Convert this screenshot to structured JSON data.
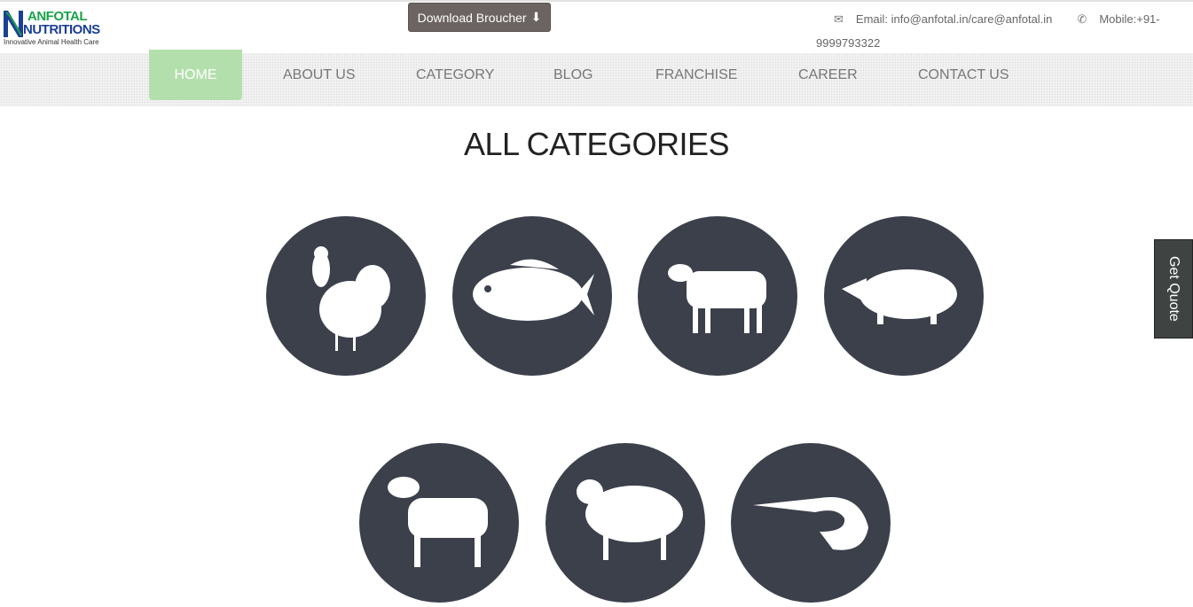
{
  "header": {
    "logo": {
      "line1": "ANFOTAL",
      "line2": "NUTRITIONS",
      "tagline": "Innovative Animal Health Care"
    },
    "download_label": "Download Broucher",
    "email": "Email: info@anfotal.in/care@anfotal.in",
    "mobile": "Mobile:+91-9999793322"
  },
  "nav": {
    "items": [
      {
        "label": "HOME",
        "active": true
      },
      {
        "label": "ABOUT US"
      },
      {
        "label": "CATEGORY"
      },
      {
        "label": "BLOG"
      },
      {
        "label": "FRANCHISE"
      },
      {
        "label": "CAREER"
      },
      {
        "label": "CONTACT US"
      }
    ]
  },
  "main": {
    "title": "ALL CATEGORIES",
    "categories": [
      {
        "icon": "chicken-icon"
      },
      {
        "icon": "fish-icon"
      },
      {
        "icon": "cow-icon"
      },
      {
        "icon": "pig-icon"
      },
      {
        "icon": "goat-icon"
      },
      {
        "icon": "sheep-icon"
      },
      {
        "icon": "shrimp-icon"
      }
    ]
  },
  "get_quote": "Get Quote",
  "colors": {
    "active_nav": "#b3dfac",
    "circle": "#3c404b",
    "download": "#6b6462"
  }
}
